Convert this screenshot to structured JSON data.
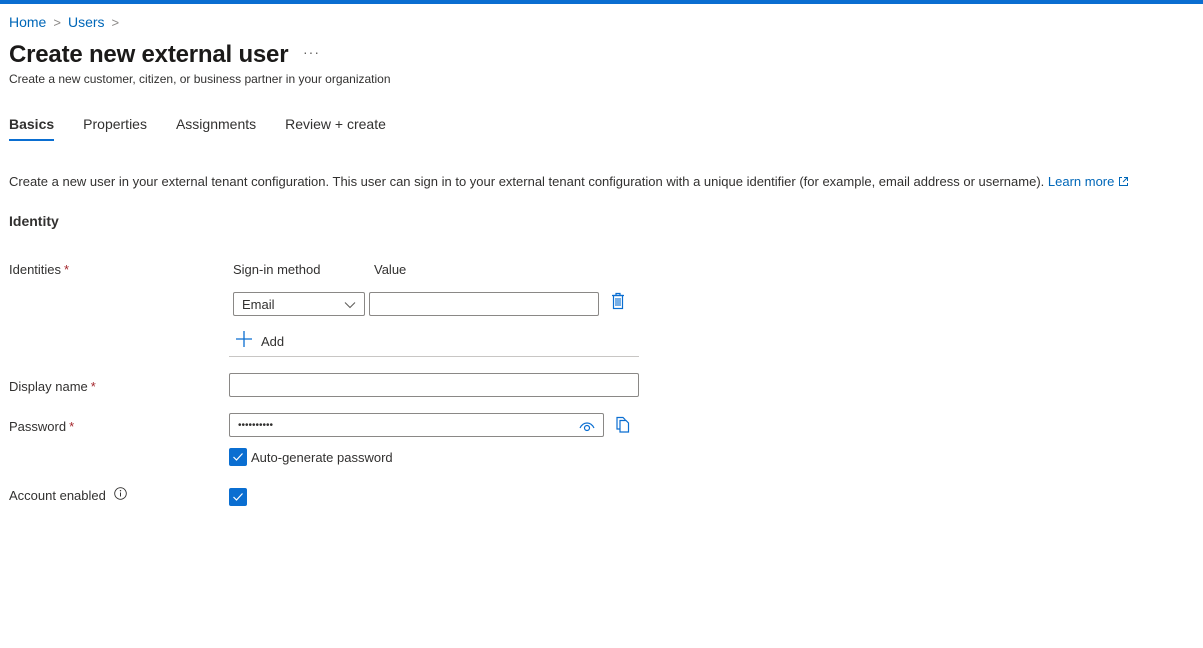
{
  "breadcrumb": [
    {
      "label": "Home"
    },
    {
      "label": "Users"
    }
  ],
  "page": {
    "title": "Create new external user",
    "more_label": "···",
    "subtitle": "Create a new customer, citizen, or business partner in your organization"
  },
  "tabs": [
    {
      "label": "Basics",
      "active": true
    },
    {
      "label": "Properties",
      "active": false
    },
    {
      "label": "Assignments",
      "active": false
    },
    {
      "label": "Review + create",
      "active": false
    }
  ],
  "description": {
    "text": "Create a new user in your external tenant configuration. This user can sign in to your external tenant configuration with a unique identifier (for example, email address or username).",
    "link_label": "Learn more",
    "link_icon": "external-link-icon"
  },
  "identity_section": {
    "title": "Identity",
    "identities_label": "Identities",
    "required_marker": "*",
    "columns": {
      "sign_in_method": "Sign-in method",
      "value": "Value"
    },
    "rows": [
      {
        "sign_in_method": "Email",
        "value": "",
        "delete_icon": "trash-icon"
      }
    ],
    "add_label": "Add",
    "add_icon": "plus-icon"
  },
  "display_name": {
    "label": "Display name",
    "value": "",
    "placeholder": ""
  },
  "password": {
    "label": "Password",
    "value": "••••••••••",
    "reveal_icon": "eye-icon",
    "copy_icon": "copy-icon"
  },
  "auto_generate": {
    "label": "Auto-generate password",
    "checked": true
  },
  "account_enabled": {
    "label": "Account enabled",
    "info_icon": "info-icon",
    "checked": true
  },
  "colors": {
    "accent": "#0a6ed1",
    "link": "#0067b8",
    "required": "#a4262c"
  }
}
